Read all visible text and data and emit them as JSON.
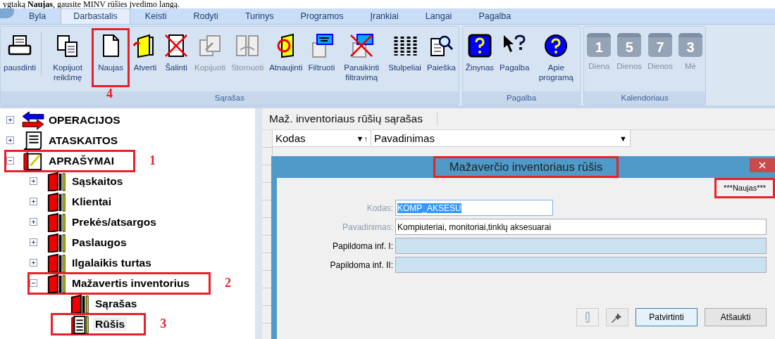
{
  "document_line": "ygtaką **Naujas**, gausite MINV rūšies įvedimo langą.",
  "ribbon_tabs": [
    {
      "label": "Byla",
      "selected": false
    },
    {
      "label": "Darbastalis",
      "selected": true
    },
    {
      "label": "Keisti",
      "selected": false
    },
    {
      "label": "Rodyti",
      "selected": false
    },
    {
      "label": "Turinys",
      "selected": false
    },
    {
      "label": "Programos",
      "selected": false
    },
    {
      "label": "Įrankiai",
      "selected": false
    },
    {
      "label": "Langai",
      "selected": false
    },
    {
      "label": "Pagalba",
      "selected": false
    }
  ],
  "ribbon_groups": [
    {
      "label": "Sąrašas",
      "buttons": [
        {
          "kind": "printer",
          "label": "pausdinti",
          "disabled": false
        },
        {
          "kind": "copy",
          "label": "Kopijuot reikšmę",
          "disabled": false,
          "separator_before": true
        },
        {
          "kind": "page",
          "label": "Naujas",
          "disabled": false,
          "callout": "4"
        },
        {
          "kind": "folder",
          "label": "Atverti",
          "disabled": false
        },
        {
          "kind": "delete",
          "label": "Šalinti",
          "disabled": false
        },
        {
          "kind": "copy2",
          "label": "Kopijuoti",
          "disabled": true
        },
        {
          "kind": "swap",
          "label": "Stornuoti",
          "disabled": true
        },
        {
          "kind": "refresh",
          "label": "Atnaujinti",
          "disabled": false
        },
        {
          "kind": "filter",
          "label": "Filtruoti",
          "disabled": false
        },
        {
          "kind": "filteroff",
          "label": "Panaikinti filtravimą",
          "disabled": false
        },
        {
          "kind": "columns",
          "label": "Stulpeliai",
          "disabled": false
        },
        {
          "kind": "search",
          "label": "Paieška",
          "disabled": false
        }
      ]
    },
    {
      "label": "Pagalba",
      "buttons": [
        {
          "kind": "helpbox",
          "label": "Žinynas",
          "disabled": false
        },
        {
          "kind": "pointer",
          "label": "Pagalba",
          "disabled": false
        },
        {
          "kind": "helpcircle",
          "label": "Apie programą",
          "disabled": false
        }
      ]
    },
    {
      "label": "Kalendoriaus",
      "buttons": [
        {
          "kind": "calendar",
          "day": "1",
          "label": "Diena",
          "disabled": true
        },
        {
          "kind": "calendar",
          "day": "5",
          "label": "Dienos",
          "disabled": true
        },
        {
          "kind": "calendar",
          "day": "7",
          "label": "Dienos",
          "disabled": true
        },
        {
          "kind": "calendar",
          "day": "3",
          "label": "Mė",
          "disabled": true
        }
      ]
    }
  ],
  "tree": [
    {
      "label": "OPERACIJOS",
      "kind": "arrows",
      "expanded": false,
      "selected": false
    },
    {
      "label": "ATASKAITOS",
      "kind": "scroll",
      "expanded": false,
      "selected": false
    },
    {
      "label": "APRAŠYMAI",
      "kind": "notepad",
      "expanded": true,
      "selected": false,
      "callout": "1",
      "children": [
        {
          "label": "Sąskaitos",
          "kind": "book",
          "expanded": false,
          "selected": false
        },
        {
          "label": "Klientai",
          "kind": "book",
          "expanded": false,
          "selected": false
        },
        {
          "label": "Prekės/atsargos",
          "kind": "book",
          "expanded": false,
          "selected": false
        },
        {
          "label": "Paslaugos",
          "kind": "book",
          "expanded": false,
          "selected": false
        },
        {
          "label": "Ilgalaikis turtas",
          "kind": "book",
          "expanded": false,
          "selected": false
        },
        {
          "label": "Mažavertis inventorius",
          "kind": "book",
          "expanded": true,
          "selected": false,
          "callout": "2",
          "children": [
            {
              "label": "Sąrašas",
              "kind": "book",
              "selected": false
            },
            {
              "label": "Rūšis",
              "kind": "list",
              "selected": true,
              "callout": "3"
            }
          ]
        }
      ]
    }
  ],
  "list_panel": {
    "title": "Maž. inventoriaus rūšių sąrašas",
    "columns": [
      {
        "label": "Kodas",
        "sort_mark": "▼↑"
      },
      {
        "label": "Pavadinimas",
        "sort_mark": "▼"
      }
    ]
  },
  "dialog": {
    "title": "Mažaverčio inventoriaus rūšis",
    "title_highlighted": true,
    "mode": "***Naujas***",
    "mode_highlighted": true,
    "fields": [
      {
        "label": "Kodas:",
        "kind": "code",
        "value": "KOMP_AKSESU",
        "selected_text": true
      },
      {
        "label": "Pavadinimas:",
        "kind": "main",
        "value": "Kompiuteriai, monitoriai,tinklų aksesuarai",
        "selected_text": false
      },
      {
        "label": "Papildoma inf. I:",
        "kind": "extra"
      },
      {
        "label": "Papildoma inf. II:",
        "kind": "extra"
      }
    ],
    "buttons": [
      {
        "label": "Patvirtinti",
        "focused": true
      },
      {
        "label": "Atšaukti",
        "focused": false
      }
    ]
  }
}
